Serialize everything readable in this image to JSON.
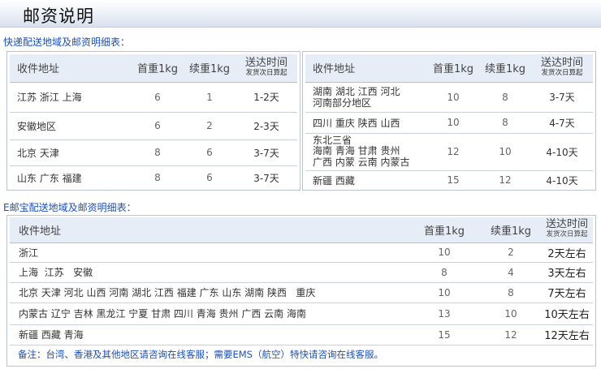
{
  "page": {
    "title": "邮资说明"
  },
  "express": {
    "section_title": "快递配送地域及邮资明细表：",
    "headers": {
      "address": "收件地址",
      "first": "首重1kg",
      "extra": "续重1kg",
      "time": "送达时间",
      "time_note": "发货次日算起"
    },
    "left_rows": [
      {
        "address": "江苏 浙江 上海",
        "first": "6",
        "extra": "1",
        "time": "1-2天"
      },
      {
        "address": "安徽地区",
        "first": "6",
        "extra": "2",
        "time": "2-3天"
      },
      {
        "address": "北京 天津",
        "first": "8",
        "extra": "6",
        "time": "3-7天"
      },
      {
        "address": "山东 广东 福建",
        "first": "8",
        "extra": "6",
        "time": "3-7天"
      }
    ],
    "right_rows": [
      {
        "address_lines": [
          "湖南 湖北 江西 河北",
          "河南部分地区"
        ],
        "first": "10",
        "extra": "8",
        "time": "3-7天"
      },
      {
        "address_lines": [
          "四川 重庆 陕西 山西"
        ],
        "first": "10",
        "extra": "8",
        "time": "4-7天"
      },
      {
        "address_lines": [
          "东北三省",
          "海南 青海 甘肃 贵州",
          "广西 内蒙 云南 内蒙古"
        ],
        "first": "12",
        "extra": "10",
        "time": "4-10天"
      },
      {
        "address_lines": [
          "新疆 西藏"
        ],
        "first": "15",
        "extra": "12",
        "time": "4-10天"
      }
    ]
  },
  "ems": {
    "section_title": "E邮宝配送地域及邮资明细表：",
    "headers": {
      "address": "收件地址",
      "first": "首重1kg",
      "extra": "续重1kg",
      "time": "送达时间",
      "time_note": "发货次日算起"
    },
    "rows": [
      {
        "address": "浙江",
        "first": "10",
        "extra": "2",
        "time": "2天左右"
      },
      {
        "address": "上海  江苏   安徽",
        "first": "8",
        "extra": "4",
        "time": "3天左右"
      },
      {
        "address": "北京 天津 河北 山西 河南 湖北 江西 福建 广东 山东 湖南 陕西   重庆",
        "first": "10",
        "extra": "8",
        "time": "7天左右"
      },
      {
        "address": "内蒙古 辽宁 吉林 黑龙江 宁夏 甘肃 四川 青海 贵州 广西 云南 海南",
        "first": "13",
        "extra": "10",
        "time": "10天左右"
      },
      {
        "address": "新疆 西藏 青海",
        "first": "15",
        "extra": "12",
        "time": "12天左右"
      }
    ],
    "note": "备注：台湾、香港及其他地区请咨询在线客服；需要EMS（航空）特快请咨询在线客服。"
  }
}
